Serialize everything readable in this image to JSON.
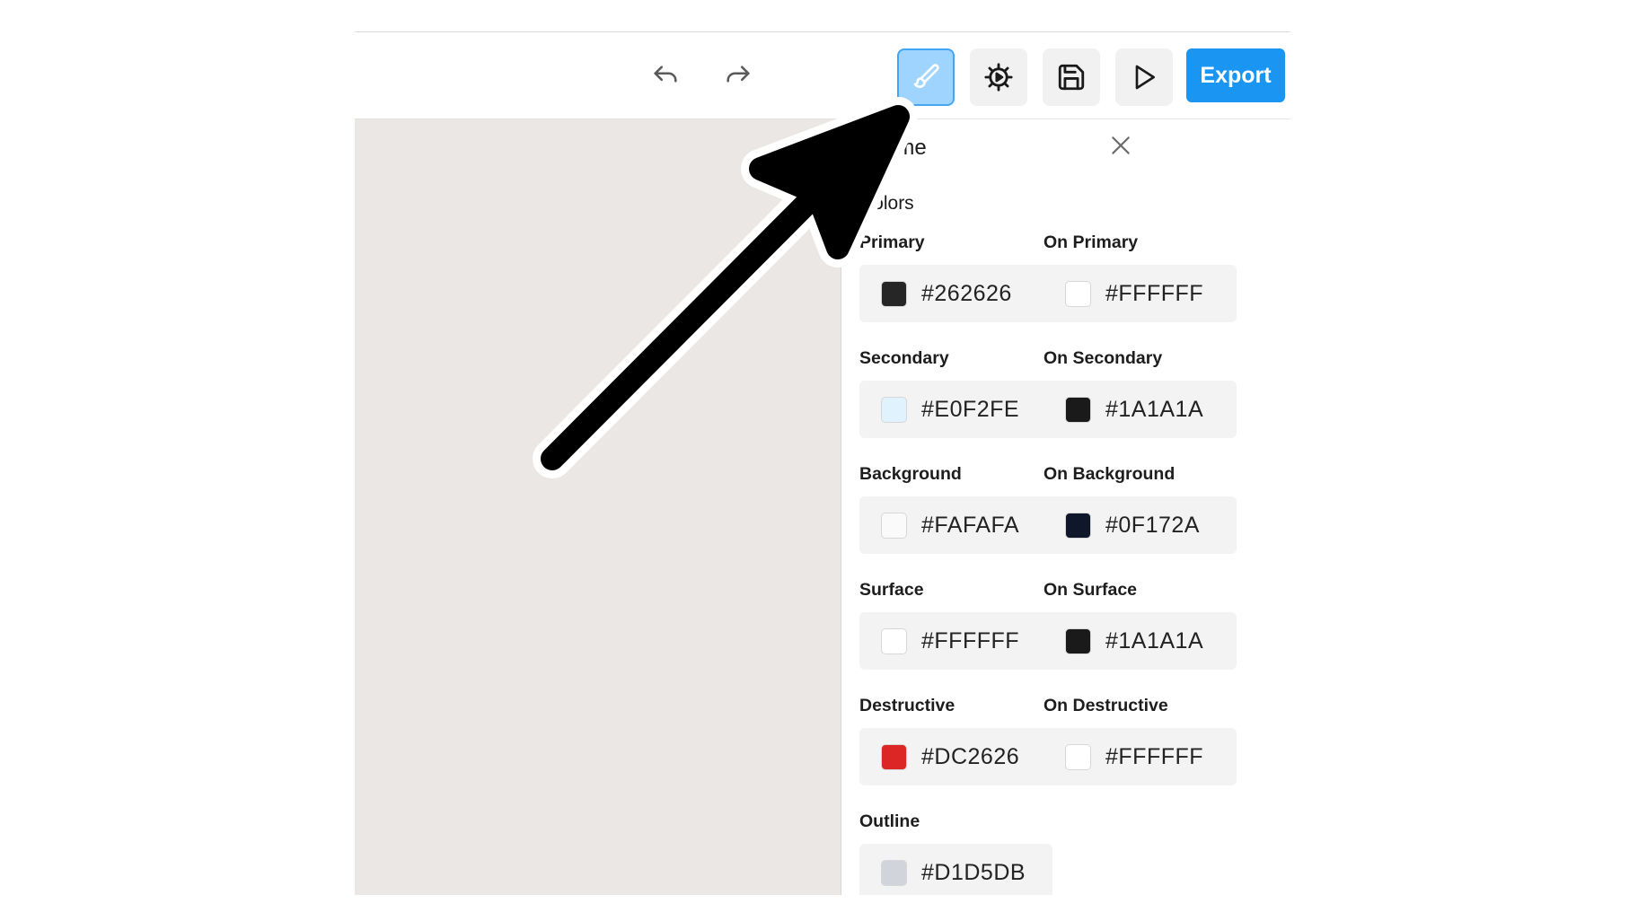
{
  "toolbar": {
    "undo_icon": "undo-arrow-icon",
    "redo_icon": "redo-arrow-icon",
    "theme_icon": "paintbrush-icon",
    "settings_icon": "gear-play-icon",
    "save_icon": "floppy-disk-icon",
    "preview_icon": "play-triangle-icon",
    "export_label": "Export",
    "export_color": "#1A96F2",
    "active_color": "#9FD4FF"
  },
  "panel": {
    "title": "Theme",
    "section": "Colors",
    "close_icon": "close-x-icon",
    "colors": [
      {
        "label": "Primary",
        "hex": "#262626",
        "swatch": "#262626"
      },
      {
        "label": "On Primary",
        "hex": "#FFFFFF",
        "swatch": "#FFFFFF"
      },
      {
        "label": "Secondary",
        "hex": "#E0F2FE",
        "swatch": "#E0F2FE"
      },
      {
        "label": "On Secondary",
        "hex": "#1A1A1A",
        "swatch": "#1A1A1A"
      },
      {
        "label": "Background",
        "hex": "#FAFAFA",
        "swatch": "#FAFAFA"
      },
      {
        "label": "On Background",
        "hex": "#0F172A",
        "swatch": "#0F172A"
      },
      {
        "label": "Surface",
        "hex": "#FFFFFF",
        "swatch": "#FFFFFF"
      },
      {
        "label": "On Surface",
        "hex": "#1A1A1A",
        "swatch": "#1A1A1A"
      },
      {
        "label": "Destructive",
        "hex": "#DC2626",
        "swatch": "#DC2626"
      },
      {
        "label": "On Destructive",
        "hex": "#FFFFFF",
        "swatch": "#FFFFFF"
      },
      {
        "label": "Outline",
        "hex": "#D1D5DB",
        "swatch": "#D1D5DB"
      }
    ]
  },
  "annotation": {
    "arrow_icon": "pointer-arrow-icon"
  }
}
